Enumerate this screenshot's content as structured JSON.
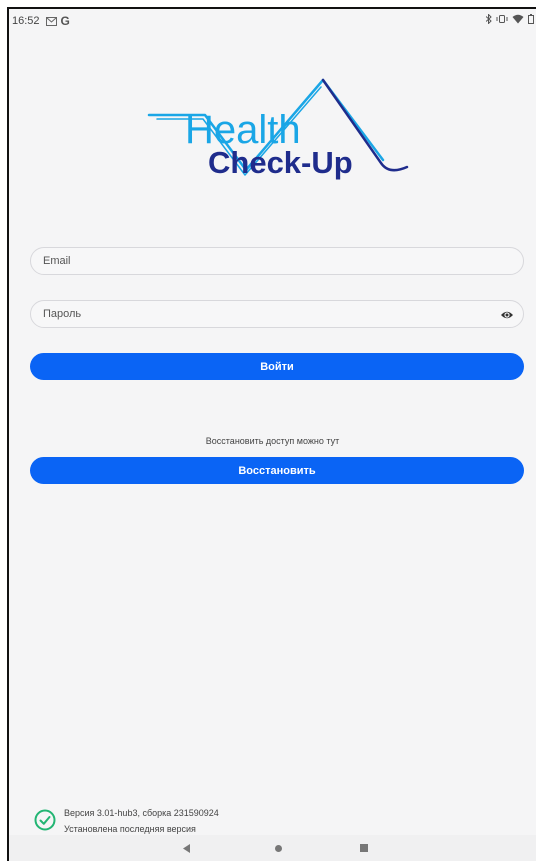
{
  "status_bar": {
    "time": "16:52",
    "left_icons": [
      "gmail-icon",
      "google-icon"
    ],
    "google_glyph": "G",
    "right_icons": [
      "bluetooth-icon",
      "vibrate-icon",
      "wifi-icon",
      "battery-icon"
    ]
  },
  "logo": {
    "line1": "Health",
    "line2": "Check-Up",
    "colors": {
      "cyan": "#1aa6e6",
      "navy": "#1f2c8c"
    }
  },
  "login": {
    "email_placeholder": "Email",
    "password_placeholder": "Пароль",
    "login_button": "Войти"
  },
  "restore": {
    "hint": "Восстановить доступ можно тут",
    "button": "Восстановить"
  },
  "version": {
    "line1": "Версия 3.01-hub3, сборка 231590924",
    "line2": "Установлена последняя версия"
  },
  "colors": {
    "accent": "#0a64f5",
    "background": "#f5f5f6",
    "success": "#22b573"
  }
}
